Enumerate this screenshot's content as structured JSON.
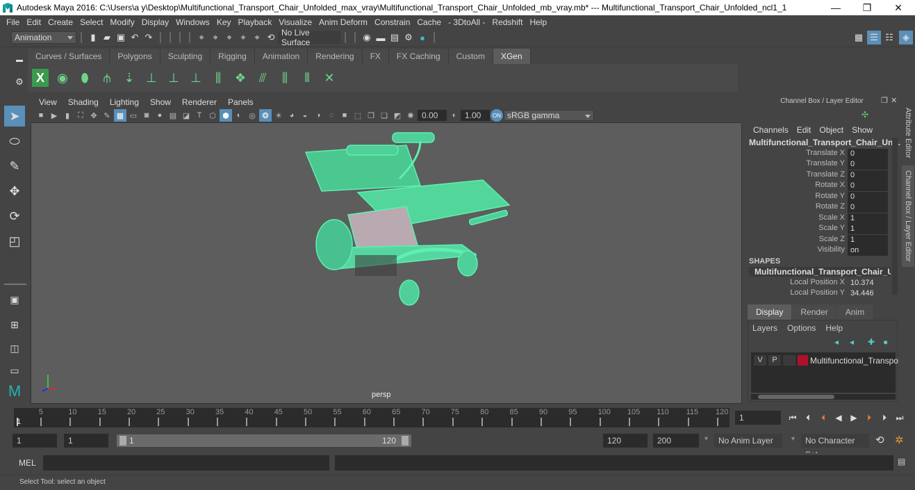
{
  "window": {
    "title": "Autodesk Maya 2016: C:\\Users\\a y\\Desktop\\Multifunctional_Transport_Chair_Unfolded_max_vray\\Multifunctional_Transport_Chair_Unfolded_mb_vray.mb*  ---  Multifunctional_Transport_Chair_Unfolded_ncl1_1",
    "minimize": "—",
    "restore": "❐",
    "close": "✕"
  },
  "menubar": [
    "File",
    "Edit",
    "Create",
    "Select",
    "Modify",
    "Display",
    "Windows",
    "Key",
    "Playback",
    "Visualize",
    "Anim Deform",
    "Constrain",
    "Cache",
    "- 3DtoAll -",
    "Redshift",
    "Help"
  ],
  "statusline": {
    "mode": "Animation",
    "live_surface": "No Live Surface"
  },
  "shelf": {
    "tabs": [
      "Curves / Surfaces",
      "Polygons",
      "Sculpting",
      "Rigging",
      "Animation",
      "Rendering",
      "FX",
      "FX Caching",
      "Custom",
      "XGen"
    ],
    "active_tab": "XGen",
    "icons": [
      "xgen-editor-icon",
      "xgen-preview-icon",
      "xgen-clear-preview-icon",
      "add-guides-icon",
      "place-guides-icon",
      "add-guide-icon",
      "sculpt-guide-icon",
      "lock-guide-icon",
      "guides-to-curves-icon",
      "create-description-icon",
      "rebuild-guides-icon",
      "select-guides-icon",
      "guide-frame-icon",
      "delete-guides-icon"
    ]
  },
  "viewport": {
    "menu": [
      "View",
      "Shading",
      "Lighting",
      "Show",
      "Renderer",
      "Panels"
    ],
    "exposure": "0.00",
    "gamma": "1.00",
    "color_space": "sRGB gamma",
    "camera_label": "persp"
  },
  "channel_box": {
    "header": "Channel Box / Layer Editor",
    "menu": [
      "Channels",
      "Edit",
      "Object",
      "Show"
    ],
    "object_name": "Multifunctional_Transport_Chair_Unf...",
    "attributes": [
      {
        "label": "Translate X",
        "value": "0"
      },
      {
        "label": "Translate Y",
        "value": "0"
      },
      {
        "label": "Translate Z",
        "value": "0"
      },
      {
        "label": "Rotate X",
        "value": "0"
      },
      {
        "label": "Rotate Y",
        "value": "0"
      },
      {
        "label": "Rotate Z",
        "value": "0"
      },
      {
        "label": "Scale X",
        "value": "1"
      },
      {
        "label": "Scale Y",
        "value": "1"
      },
      {
        "label": "Scale Z",
        "value": "1"
      },
      {
        "label": "Visibility",
        "value": "on"
      }
    ],
    "shapes_label": "SHAPES",
    "shape_name": "Multifunctional_Transport_Chair_Un...",
    "shape_attributes": [
      {
        "label": "Local Position X",
        "value": "10.374"
      },
      {
        "label": "Local Position Y",
        "value": "34.446"
      }
    ]
  },
  "side_tabs": [
    "Attribute Editor",
    "Channel Box / Layer Editor"
  ],
  "layer_editor": {
    "tabs": [
      "Display",
      "Render",
      "Anim"
    ],
    "active_tab": "Display",
    "menu": [
      "Layers",
      "Options",
      "Help"
    ],
    "layers": [
      {
        "v": "V",
        "p": "P",
        "name": "Multifunctional_Transpo",
        "color": "#b0102a"
      }
    ]
  },
  "timeline": {
    "ticks": [
      5,
      10,
      15,
      20,
      25,
      30,
      35,
      40,
      45,
      50,
      55,
      60,
      65,
      70,
      75,
      80,
      85,
      90,
      95,
      100,
      105,
      110,
      115,
      120
    ],
    "start_visible": 1,
    "end": 120,
    "current_frame": "1",
    "current_label": "1"
  },
  "range": {
    "start": "1",
    "playback_start": "1",
    "slider_min": "1",
    "slider_max": "120",
    "playback_end": "120",
    "end": "200",
    "anim_layer": "No Anim Layer",
    "character_set": "No Character Set"
  },
  "command_line": {
    "label": "MEL"
  },
  "help_line": "Select Tool: select an object"
}
